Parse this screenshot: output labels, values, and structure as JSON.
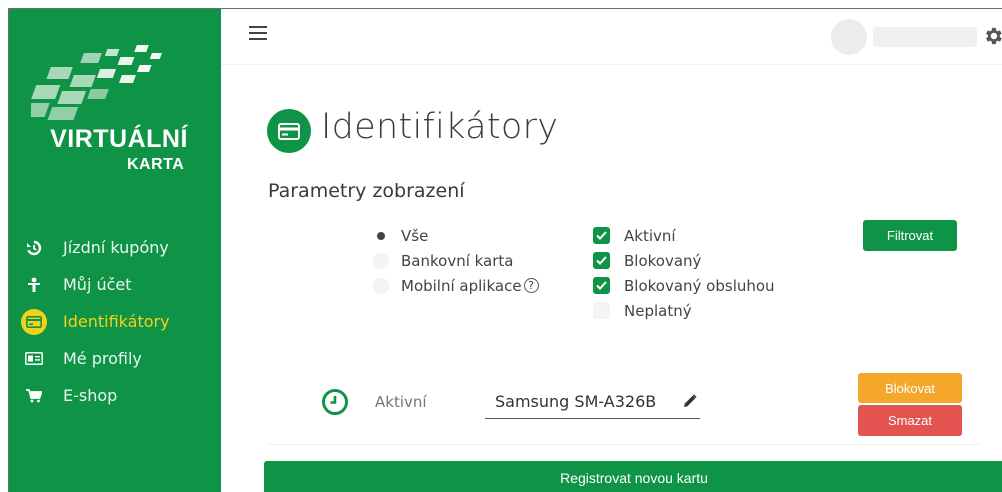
{
  "brand": {
    "title": "VIRTUÁLNÍ",
    "subtitle": "KARTA",
    "color": "#0f9447",
    "accent": "#f2d21b"
  },
  "sidebar": {
    "items": [
      {
        "label": "Jízdní kupóny",
        "icon": "history-icon",
        "active": false
      },
      {
        "label": "Můj účet",
        "icon": "user-icon",
        "active": false
      },
      {
        "label": "Identifikátory",
        "icon": "card-icon",
        "active": true
      },
      {
        "label": "Mé profily",
        "icon": "id-card-icon",
        "active": false
      },
      {
        "label": "E-shop",
        "icon": "cart-icon",
        "active": false
      }
    ]
  },
  "topbar": {
    "menu_icon": "hamburger-icon",
    "settings_icon": "gear-icon"
  },
  "page": {
    "title": "Identifikátory",
    "icon": "card-icon",
    "section_title": "Parametry zobrazení"
  },
  "filters": {
    "radios": [
      {
        "label": "Vše",
        "selected": true
      },
      {
        "label": "Bankovní karta",
        "selected": false
      },
      {
        "label": "Mobilní aplikace",
        "selected": false,
        "help": "?"
      }
    ],
    "checks": [
      {
        "label": "Aktivní",
        "checked": true
      },
      {
        "label": "Blokovaný",
        "checked": true
      },
      {
        "label": "Blokovaný obsluhou",
        "checked": true
      },
      {
        "label": "Neplatný",
        "checked": false
      }
    ],
    "filter_button": "Filtrovat"
  },
  "card": {
    "status": "Aktivní",
    "device_name": "Samsung SM-A326B",
    "block_button": "Blokovat",
    "delete_button": "Smazat",
    "block_color": "#f4a72b",
    "delete_color": "#e3534f"
  },
  "register_button": "Registrovat novou kartu"
}
